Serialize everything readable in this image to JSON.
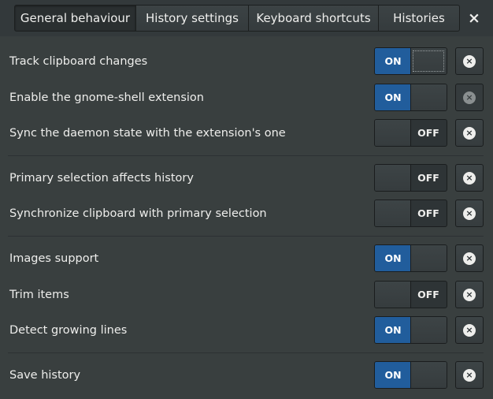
{
  "tabs": [
    {
      "label": "General behaviour",
      "active": true
    },
    {
      "label": "History settings",
      "active": false
    },
    {
      "label": "Keyboard shortcuts",
      "active": false
    },
    {
      "label": "Histories",
      "active": false
    }
  ],
  "close_glyph": "×",
  "switch_text": {
    "on": "ON",
    "off": "OFF"
  },
  "reset_glyph": "×",
  "settings": [
    {
      "label": "Track clipboard changes",
      "state": true
    },
    {
      "label": "Enable the gnome-shell extension",
      "state": true
    },
    {
      "label": "Sync the daemon state with the extension's one",
      "state": false
    },
    {
      "label": "Primary selection affects history",
      "state": false
    },
    {
      "label": "Synchronize clipboard with primary selection",
      "state": false
    },
    {
      "label": "Images support",
      "state": true
    },
    {
      "label": "Trim items",
      "state": false
    },
    {
      "label": "Detect growing lines",
      "state": true
    },
    {
      "label": "Save history",
      "state": true
    }
  ],
  "colors": {
    "accent": "#215d9c",
    "background": "#393f3f"
  }
}
